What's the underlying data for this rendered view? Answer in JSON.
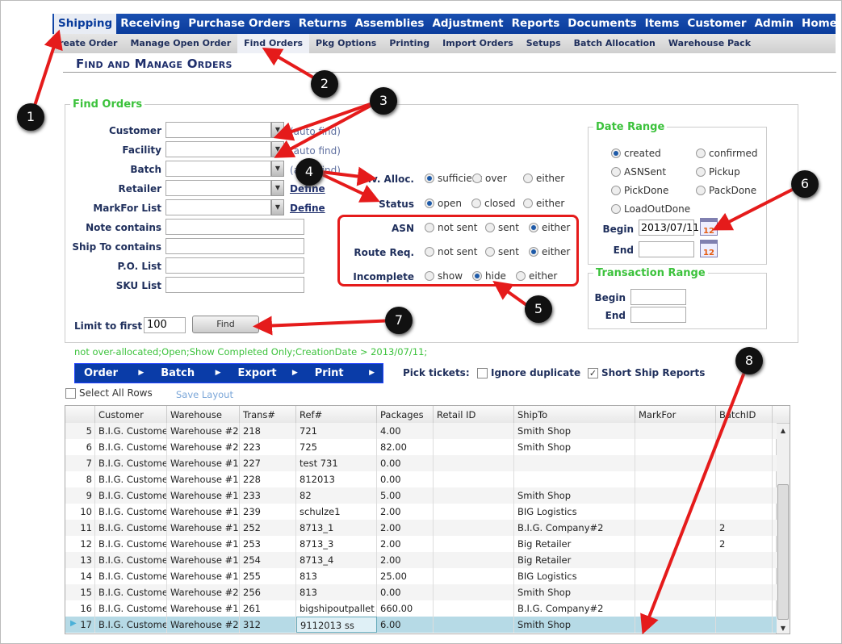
{
  "nav": {
    "tabs": [
      "Shipping",
      "Receiving",
      "Purchase Orders",
      "Returns",
      "Assemblies",
      "Adjustment",
      "Reports",
      "Documents",
      "Items",
      "Customer",
      "Admin",
      "Home"
    ],
    "active": "Shipping"
  },
  "subnav": {
    "tabs": [
      "Create Order",
      "Manage Open Order",
      "Find Orders",
      "Pkg Options",
      "Printing",
      "Import Orders",
      "Setups",
      "Batch Allocation",
      "Warehouse Pack"
    ],
    "active": "Find Orders"
  },
  "page_title": "Find and Manage Orders",
  "find_orders": {
    "legend": "Find Orders",
    "customer_label": "Customer",
    "facility_label": "Facility",
    "batch_label": "Batch",
    "retailer_label": "Retailer",
    "markfor_label": "MarkFor List",
    "auto_find": "(auto find)",
    "define": "Define",
    "note_label": "Note contains",
    "shipto_label": "Ship To contains",
    "po_label": "P.O. List",
    "sku_label": "SKU List",
    "inv_alloc": {
      "label": "Inv. Alloc.",
      "options": [
        "sufficient",
        "over",
        "either"
      ],
      "selected": 0
    },
    "status": {
      "label": "Status",
      "options": [
        "open",
        "closed",
        "either"
      ],
      "selected": 0
    },
    "asn": {
      "label": "ASN",
      "options": [
        "not sent",
        "sent",
        "either"
      ],
      "selected": 2
    },
    "route_req": {
      "label": "Route Req.",
      "options": [
        "not sent",
        "sent",
        "either"
      ],
      "selected": 2
    },
    "incomplete": {
      "label": "Incomplete",
      "options": [
        "show",
        "hide",
        "either"
      ],
      "selected": 1
    },
    "limit_label": "Limit to first",
    "limit_value": "100",
    "find_button": "Find"
  },
  "date_range": {
    "legend": "Date Range",
    "options": [
      "created",
      "confirmed",
      "ASNSent",
      "Pickup",
      "PickDone",
      "PackDone",
      "LoadOutDone"
    ],
    "selected": 0,
    "begin_label": "Begin",
    "begin_value": "2013/07/11",
    "end_label": "End",
    "end_value": "",
    "calendar_icon_text": "12"
  },
  "transaction_range": {
    "legend": "Transaction Range",
    "begin_label": "Begin",
    "end_label": "End"
  },
  "filter_summary": "not over-allocated;Open;Show Completed Only;CreationDate > 2013/07/11;",
  "menubar": [
    "Order",
    "Batch",
    "Export",
    "Print"
  ],
  "pick_tickets": {
    "label": "Pick tickets:",
    "ignore_duplicate": "Ignore duplicate",
    "ignore_checked": false,
    "short_ship": "Short Ship Reports",
    "short_checked": true
  },
  "select_all": "Select All Rows",
  "save_layout": "Save Layout",
  "grid": {
    "columns": [
      "",
      "Customer",
      "Warehouse",
      "Trans#",
      "Ref#",
      "Packages",
      "Retail ID",
      "ShipTo",
      "MarkFor",
      "BatchID"
    ],
    "rows": [
      [
        "5",
        "B.I.G. Customer",
        "Warehouse #2",
        "218",
        "721",
        "4.00",
        "",
        "Smith Shop",
        "",
        ""
      ],
      [
        "6",
        "B.I.G. Customer",
        "Warehouse #2",
        "223",
        "725",
        "82.00",
        "",
        "Smith Shop",
        "",
        ""
      ],
      [
        "7",
        "B.I.G. Customer",
        "Warehouse #1",
        "227",
        "test 731",
        "0.00",
        "",
        "",
        "",
        ""
      ],
      [
        "8",
        "B.I.G. Customer",
        "Warehouse #1",
        "228",
        "812013",
        "0.00",
        "",
        "",
        "",
        ""
      ],
      [
        "9",
        "B.I.G. Customer",
        "Warehouse #1",
        "233",
        "82",
        "5.00",
        "",
        "Smith Shop",
        "",
        ""
      ],
      [
        "10",
        "B.I.G. Customer",
        "Warehouse #1",
        "239",
        "schulze1",
        "2.00",
        "",
        "BIG Logistics",
        "",
        ""
      ],
      [
        "11",
        "B.I.G. Customer",
        "Warehouse #1",
        "252",
        "8713_1",
        "2.00",
        "",
        "B.I.G. Company#2",
        "",
        "2"
      ],
      [
        "12",
        "B.I.G. Customer",
        "Warehouse #1",
        "253",
        "8713_3",
        "2.00",
        "",
        "Big Retailer",
        "",
        "2"
      ],
      [
        "13",
        "B.I.G. Customer",
        "Warehouse #1",
        "254",
        "8713_4",
        "2.00",
        "",
        "Big Retailer",
        "",
        ""
      ],
      [
        "14",
        "B.I.G. Customer",
        "Warehouse #1",
        "255",
        "813",
        "25.00",
        "",
        "BIG Logistics",
        "",
        ""
      ],
      [
        "15",
        "B.I.G. Customer",
        "Warehouse #2",
        "256",
        "813",
        "0.00",
        "",
        "Smith Shop",
        "",
        ""
      ],
      [
        "16",
        "B.I.G. Customer",
        "Warehouse #1",
        "261",
        "bigshipoutpallet",
        "660.00",
        "",
        "B.I.G. Company#2",
        "",
        ""
      ],
      [
        "17",
        "B.I.G. Customer",
        "Warehouse #2",
        "312",
        "9112013 ss",
        "6.00",
        "",
        "Smith Shop",
        "",
        ""
      ]
    ],
    "selected_row": "17"
  },
  "annotations": {
    "badges": [
      "1",
      "2",
      "3",
      "4",
      "5",
      "6",
      "7",
      "8"
    ],
    "color": "#e51b1b"
  }
}
